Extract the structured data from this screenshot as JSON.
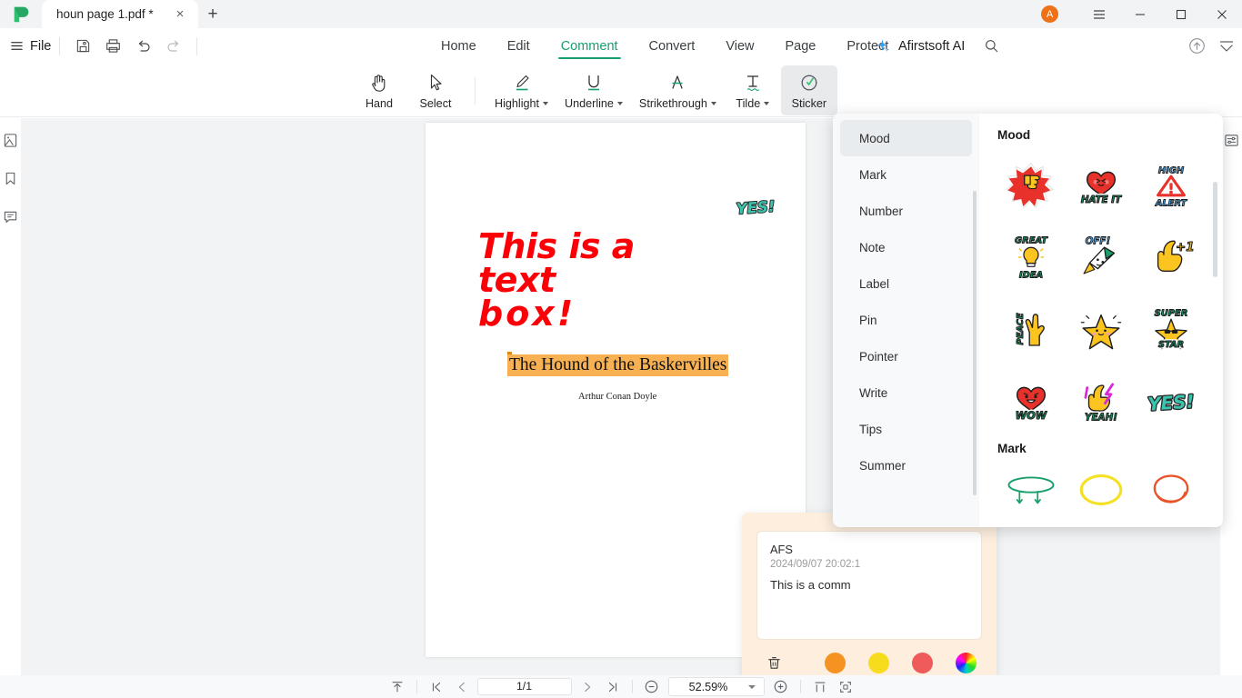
{
  "window": {
    "tab_title": "houn page 1.pdf *",
    "close_label": "×",
    "newtab_label": "+",
    "avatar_initial": "A",
    "minimize_label": "minimize",
    "maximize_label": "maximize",
    "close_window_label": "close"
  },
  "menu": {
    "file_label": "File",
    "tabs": [
      {
        "label": "Home",
        "active": false
      },
      {
        "label": "Edit",
        "active": false
      },
      {
        "label": "Comment",
        "active": true
      },
      {
        "label": "Convert",
        "active": false
      },
      {
        "label": "View",
        "active": false
      },
      {
        "label": "Page",
        "active": false
      },
      {
        "label": "Protect",
        "active": false
      }
    ],
    "ai_label": "Afirstsoft AI",
    "accent_color": "#14a06e"
  },
  "ribbon": {
    "tools": [
      {
        "label": "Hand",
        "icon": "hand-icon",
        "caret": false,
        "active": false
      },
      {
        "label": "Select",
        "icon": "cursor-icon",
        "caret": false,
        "active": false
      },
      {
        "label": "Highlight",
        "icon": "highlight-icon",
        "caret": true,
        "active": false
      },
      {
        "label": "Underline",
        "icon": "underline-icon",
        "caret": true,
        "active": false
      },
      {
        "label": "Strikethrough",
        "icon": "strikethrough-icon",
        "caret": true,
        "active": false
      },
      {
        "label": "Tilde",
        "icon": "tilde-icon",
        "caret": true,
        "active": false
      },
      {
        "label": "Sticker",
        "icon": "sticker-icon",
        "caret": false,
        "active": true
      }
    ]
  },
  "left_rail": [
    {
      "icon": "thumbnail-icon"
    },
    {
      "icon": "bookmark-icon"
    },
    {
      "icon": "comment-list-icon"
    }
  ],
  "right_rail": [
    {
      "icon": "properties-panel-icon"
    }
  ],
  "document": {
    "sticker_on_page": "YES!",
    "textbox_line1": "This is a text",
    "textbox_line2": "box!",
    "textbox_color": "#fb0007",
    "title": "The Hound of the Baskervilles",
    "title_highlight_color": "#f7b153",
    "author": "Arthur Conan Doyle"
  },
  "comment_popup": {
    "author": "AFS",
    "timestamp": "2024/09/07 20:02:1",
    "text": "This is a comm",
    "background": "#fdeede",
    "delete_icon": "trash-icon",
    "colors": [
      {
        "name": "orange",
        "hex": "#f59322"
      },
      {
        "name": "yellow",
        "hex": "#f7dc1e"
      },
      {
        "name": "red",
        "hex": "#ef5a5a"
      },
      {
        "name": "custom",
        "hex": "rainbow"
      }
    ]
  },
  "sticker_panel": {
    "categories": [
      {
        "label": "Mood",
        "active": true
      },
      {
        "label": "Mark",
        "active": false
      },
      {
        "label": "Number",
        "active": false
      },
      {
        "label": "Note",
        "active": false
      },
      {
        "label": "Label",
        "active": false
      },
      {
        "label": "Pin",
        "active": false
      },
      {
        "label": "Pointer",
        "active": false
      },
      {
        "label": "Write",
        "active": false
      },
      {
        "label": "Tips",
        "active": false
      },
      {
        "label": "Summer",
        "active": false
      }
    ],
    "sections": [
      {
        "title": "Mood",
        "rows": [
          [
            {
              "name": "thumbs-down-burst-sticker",
              "text": ""
            },
            {
              "name": "hate-it-heart-sticker",
              "text": "HATE IT"
            },
            {
              "name": "high-alert-sticker",
              "text": "HIGH ALERT"
            }
          ],
          [
            {
              "name": "great-idea-bulb-sticker",
              "text": "GREAT IDEA"
            },
            {
              "name": "off-rocket-sticker",
              "text": "OFF!"
            },
            {
              "name": "plus-one-hand-sticker",
              "text": "+1"
            }
          ],
          [
            {
              "name": "peace-hand-sticker",
              "text": "PEACE"
            },
            {
              "name": "star-sticker",
              "text": ""
            },
            {
              "name": "super-star-sticker",
              "text": "SUPER STAR"
            }
          ],
          [
            {
              "name": "wow-heart-sticker",
              "text": "WOW"
            },
            {
              "name": "yeah-hand-sticker",
              "text": "YEAH!"
            },
            {
              "name": "yes-text-sticker",
              "text": "YES!"
            }
          ]
        ]
      },
      {
        "title": "Mark",
        "rows": [
          [
            {
              "name": "green-ellipse-arrow-mark-sticker",
              "text": ""
            },
            {
              "name": "yellow-ellipse-mark-sticker",
              "text": ""
            },
            {
              "name": "red-ellipse-mark-sticker",
              "text": ""
            }
          ]
        ]
      }
    ]
  },
  "statusbar": {
    "fit_icon": "fit-page-icon",
    "first_page_icon": "first-page-icon",
    "prev_page_icon": "prev-page-icon",
    "page_value": "1/1",
    "next_page_icon": "next-page-icon",
    "last_page_icon": "last-page-icon",
    "zoom_out_icon": "zoom-out-icon",
    "zoom_value": "52.59%",
    "zoom_in_icon": "zoom-in-icon",
    "split_icon": "split-view-icon",
    "fullscreen_icon": "fullscreen-icon"
  }
}
